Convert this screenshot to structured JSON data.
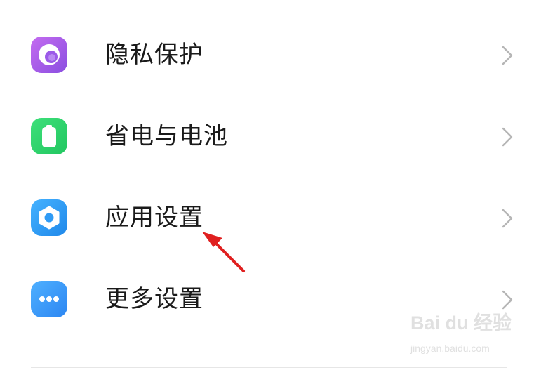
{
  "settings": {
    "items": [
      {
        "label": "隐私保护",
        "icon": "privacy-icon",
        "icon_color": "#a05ce6"
      },
      {
        "label": "省电与电池",
        "icon": "battery-icon",
        "icon_color": "#2fd36c"
      },
      {
        "label": "应用设置",
        "icon": "gear-icon",
        "icon_color": "#2f9bf5"
      },
      {
        "label": "更多设置",
        "icon": "more-dots-icon",
        "icon_color": "#3d96f7"
      }
    ]
  },
  "annotation": {
    "arrow_color": "#e02020"
  },
  "watermark": {
    "logo_text": "Bai du 经验",
    "url": "jingyan.baidu.com"
  }
}
